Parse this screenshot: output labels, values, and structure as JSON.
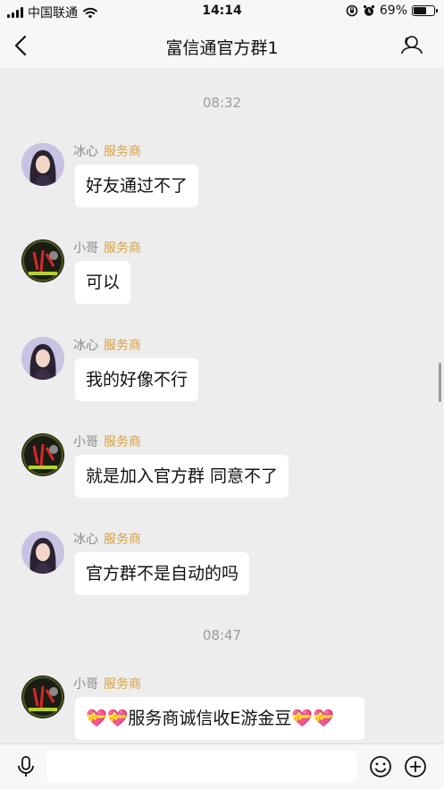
{
  "status_bar": {
    "carrier": "中国联通",
    "time": "14:14",
    "battery_text": "69%",
    "battery_level": 0.69
  },
  "header": {
    "title": "富信通官方群1"
  },
  "icons": {
    "back": "chevron-left-icon",
    "profile": "group-profile-icon",
    "voice": "microphone-icon",
    "emoji": "smiley-icon",
    "more": "plus-circle-icon"
  },
  "chat": {
    "timestamps": [
      "08:32",
      "08:47"
    ],
    "messages": [
      {
        "sender": "冰心",
        "role": "服务商",
        "text": "好友通过不了"
      },
      {
        "sender": "小哥",
        "role": "服务商",
        "text": "可以"
      },
      {
        "sender": "冰心",
        "role": "服务商",
        "text": "我的好像不行"
      },
      {
        "sender": "小哥",
        "role": "服务商",
        "text": "就是加入官方群 同意不了"
      },
      {
        "sender": "冰心",
        "role": "服务商",
        "text": "官方群不是自动的吗"
      },
      {
        "sender": "小哥",
        "role": "服务商",
        "text": "服务商诚信收E游金豆"
      }
    ],
    "emoji": "💝"
  },
  "colors": {
    "background": "#ededed",
    "bar": "#f7f7f7",
    "role_tag": "#d4a34c",
    "bubble": "#ffffff"
  }
}
